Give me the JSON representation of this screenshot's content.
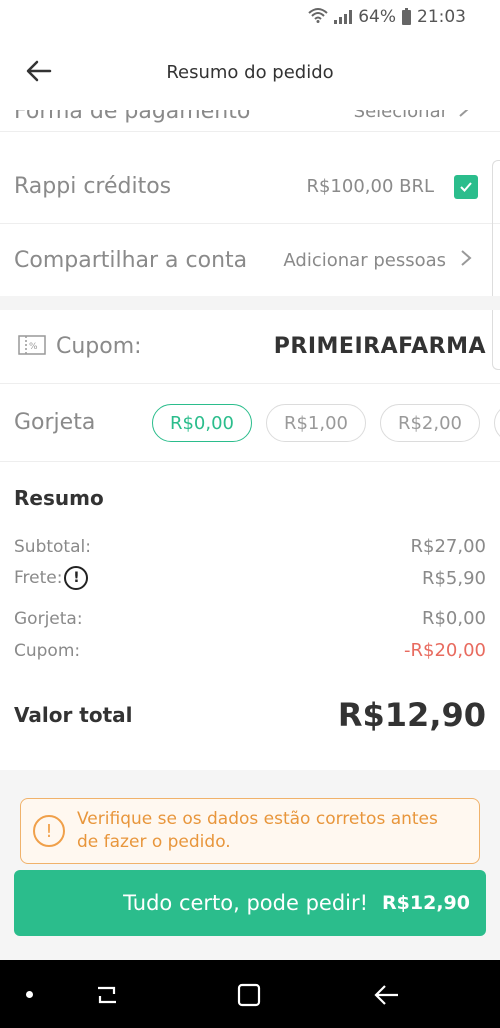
{
  "status": {
    "battery": "64%",
    "time": "21:03"
  },
  "header": {
    "title": "Resumo do pedido"
  },
  "payment": {
    "label": "Forma de pagamento",
    "action": "Selecionar"
  },
  "credits": {
    "label": "Rappi créditos",
    "amount": "R$100,00 BRL",
    "checked": true
  },
  "share": {
    "label": "Compartilhar a conta",
    "action": "Adicionar pessoas"
  },
  "coupon": {
    "label": "Cupom:",
    "code": "PRIMEIRAFARMA"
  },
  "tip": {
    "label": "Gorjeta",
    "options": [
      "R$0,00",
      "R$1,00",
      "R$2,00"
    ],
    "selected_index": 0
  },
  "summary": {
    "title": "Resumo",
    "rows": [
      {
        "label": "Subtotal:",
        "value": "R$27,00"
      },
      {
        "label": "Frete:",
        "value": "R$5,90"
      },
      {
        "label": "Gorjeta:",
        "value": "R$0,00"
      },
      {
        "label": "Cupom:",
        "value": "-R$20,00"
      }
    ],
    "total_label": "Valor total",
    "total_value": "R$12,90"
  },
  "warning": {
    "text_line1": "Verifique se os dados estão corretos antes",
    "text_line2": "de fazer o pedido."
  },
  "cta": {
    "label": "Tudo certo, pode pedir!",
    "price": "R$12,90"
  },
  "colors": {
    "accent": "#2bbd8c",
    "warning": "#f0a04a",
    "discount": "#e86b5f"
  }
}
